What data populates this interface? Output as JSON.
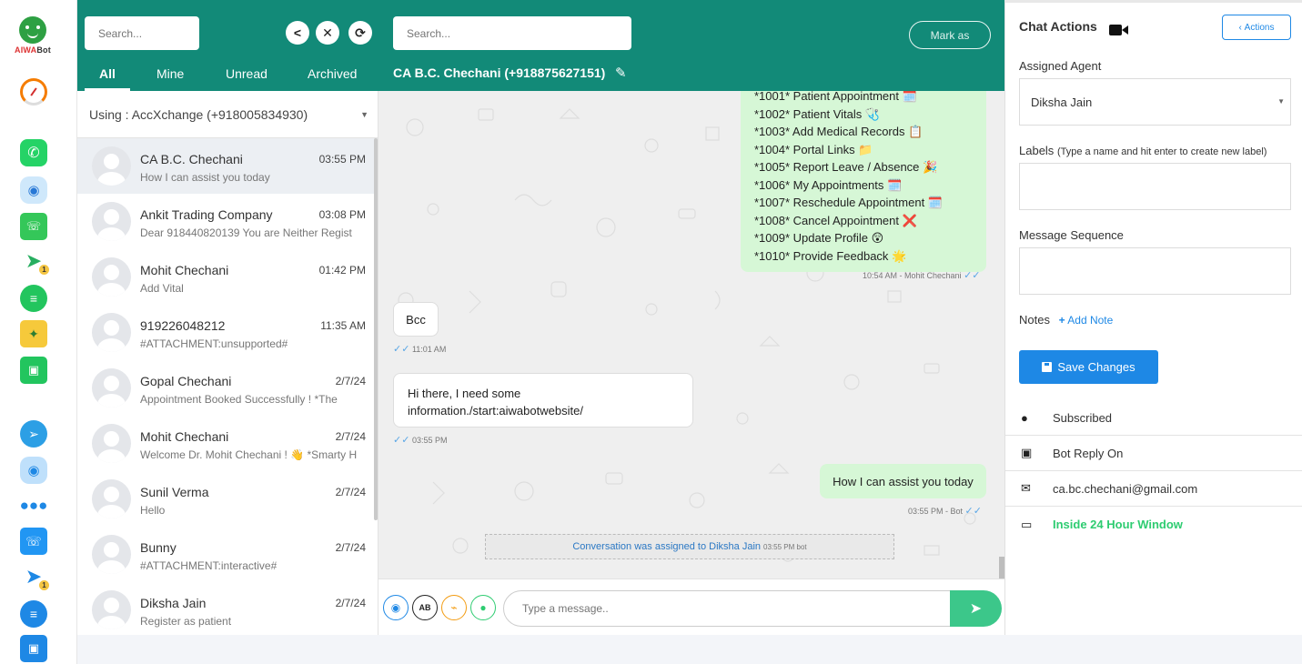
{
  "brand": {
    "name_part1": "AIWA",
    "name_part2": "Bot"
  },
  "rail": {
    "icons": [
      "speed-gauge-icon",
      "whatsapp-icon",
      "bot-icon",
      "phone-app-icon",
      "campaign-icon",
      "chat-icon",
      "puzzle-icon",
      "shop-icon",
      "telegram-icon",
      "bot-blue-icon",
      "team-icon",
      "call-icon",
      "campaign-blue-icon",
      "chat-blue-icon",
      "shop-blue-icon"
    ]
  },
  "header": {
    "left_search_placeholder": "Search...",
    "right_search_placeholder": "Search...",
    "mark_as_label": "Mark as",
    "tabs": [
      {
        "label": "All"
      },
      {
        "label": "Mine"
      },
      {
        "label": "Unread"
      },
      {
        "label": "Archived"
      }
    ],
    "chat_title": "CA B.C. Chechani (+918875627151)"
  },
  "list": {
    "using_label": "Using : AccXchange (+918005834930)",
    "conversations": [
      {
        "name": "CA B.C. Chechani",
        "time": "03:55 PM",
        "preview": "How I can assist you today"
      },
      {
        "name": "Ankit Trading Company",
        "time": "03:08 PM",
        "preview": "Dear 918440820139 You are Neither Regist"
      },
      {
        "name": "Mohit Chechani",
        "time": "01:42 PM",
        "preview": "Add Vital"
      },
      {
        "name": "919226048212",
        "time": "11:35 AM",
        "preview": "#ATTACHMENT:unsupported#"
      },
      {
        "name": "Gopal Chechani",
        "time": "2/7/24",
        "preview": "Appointment Booked Successfully ! *The"
      },
      {
        "name": "Mohit Chechani",
        "time": "2/7/24",
        "preview": "Welcome Dr. Mohit Chechani ! 👋 *Smarty H"
      },
      {
        "name": "Sunil Verma",
        "time": "2/7/24",
        "preview": "Hello"
      },
      {
        "name": "Bunny",
        "time": "2/7/24",
        "preview": "#ATTACHMENT:interactive#"
      },
      {
        "name": "Diksha Jain",
        "time": "2/7/24",
        "preview": "Register as patient"
      }
    ]
  },
  "chat": {
    "menu_lines": [
      "*1001* Patient Appointment 🗓️",
      "*1002* Patient Vitals 🩺",
      "*1003* Add Medical Records 📋",
      "*1004* Portal Links 📁",
      "*1005* Report Leave / Absence 🎉",
      "*1006* My Appointments 🗓️",
      "*1007* Reschedule Appointment 🗓️",
      "*1008* Cancel Appointment ❌",
      "*1009* Update Profile 😲",
      "*1010* Provide Feedback 🌟"
    ],
    "menu_meta": "10:54 AM - Mohit Chechani",
    "msg_bcc": "Bcc",
    "msg_bcc_time": "11:01 AM",
    "msg_info_line1": "Hi there, I need some",
    "msg_info_line2": "information./start:aiwabotwebsite/",
    "msg_info_time": "03:55 PM",
    "msg_reply": "How I can assist you today",
    "msg_reply_meta": "03:55 PM - Bot",
    "system_note": "Conversation was assigned to Diksha Jain",
    "system_note_meta": "03:55 PM bot"
  },
  "composer": {
    "placeholder": "Type a message.."
  },
  "right": {
    "title": "Chat Actions",
    "actions_label": "Actions",
    "assigned_agent_label": "Assigned Agent",
    "assigned_agent_value": "Diksha Jain",
    "labels_label": "Labels",
    "labels_hint": "(Type a name and hit enter to create new label)",
    "message_sequence_label": "Message Sequence",
    "notes_label": "Notes",
    "add_note_label": "Add Note",
    "save_label": "Save Changes",
    "info": [
      {
        "icon": "user-icon",
        "text": "Subscribed"
      },
      {
        "icon": "robot-icon",
        "text": "Bot Reply On"
      },
      {
        "icon": "envelope-icon",
        "text": "ca.bc.chechani@gmail.com"
      },
      {
        "icon": "comment-icon",
        "text": "Inside 24 Hour Window"
      }
    ],
    "accent": "#1e88e5",
    "status_color": "#2ecc71"
  },
  "colors": {
    "header": "#128a78",
    "outgoing_bubble": "#d6f7d6"
  }
}
